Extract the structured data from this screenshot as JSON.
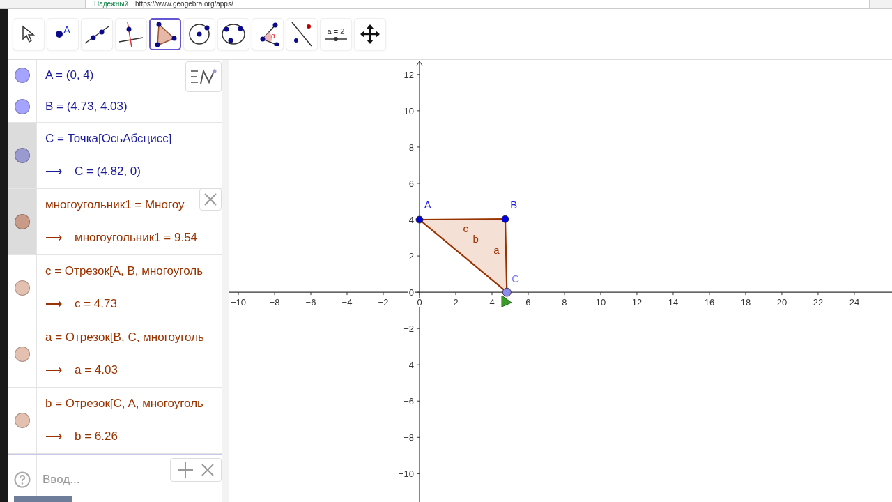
{
  "browser": {
    "security": "Надежный",
    "url": "https://www.geogebra.org/apps/"
  },
  "toolbar": [
    {
      "kind": "move",
      "selected": false
    },
    {
      "kind": "point",
      "label": "A",
      "selected": false
    },
    {
      "kind": "line",
      "selected": false
    },
    {
      "kind": "perpendicular",
      "selected": false
    },
    {
      "kind": "polygon",
      "selected": true
    },
    {
      "kind": "circle",
      "selected": false
    },
    {
      "kind": "conic",
      "selected": false
    },
    {
      "kind": "angle",
      "label": "α",
      "selected": false
    },
    {
      "kind": "reflect",
      "selected": false
    },
    {
      "kind": "slider",
      "label": "a = 2",
      "selected": false
    },
    {
      "kind": "pan",
      "selected": false
    }
  ],
  "algebra": {
    "rows": [
      {
        "kind": "point",
        "color": "#a4a4ff",
        "selected": false,
        "definition": "A = (0, 4)"
      },
      {
        "kind": "point",
        "color": "#a4a4ff",
        "selected": false,
        "definition": "B = (4.73, 4.03)"
      },
      {
        "kind": "point",
        "color": "#9a9ad0",
        "selected": true,
        "definition": "C = Точка[ОсьАбсцисс]",
        "arrow": "⟶",
        "value": "C = (4.82, 0)"
      },
      {
        "kind": "shape",
        "color": "#c99a88",
        "selected": true,
        "definition": "многоугольник1 = Многоу",
        "arrow": "⟶",
        "value": "многоугольник1 = 9.54"
      },
      {
        "kind": "shape",
        "color": "#e4c0b0",
        "selected": false,
        "definition": "c = Отрезок[A, B, многоуголь",
        "arrow": "⟶",
        "value": "c = 4.73"
      },
      {
        "kind": "shape",
        "color": "#e4c0b0",
        "selected": false,
        "definition": "a = Отрезок[B, C, многоуголь",
        "arrow": "⟶",
        "value": "a = 4.03"
      },
      {
        "kind": "shape",
        "color": "#e4c0b0",
        "selected": false,
        "definition": "b = Отрезок[C, A, многоуголь",
        "arrow": "⟶",
        "value": "b = 6.26"
      }
    ],
    "input": {
      "placeholder": "Ввод..."
    }
  },
  "graphics": {
    "chart_data": {
      "type": "area",
      "x": [
        0,
        4.73,
        4.82,
        0
      ],
      "series": [
        {
          "color": "#993300",
          "values": [
            4,
            4.03,
            0,
            4
          ]
        }
      ],
      "xlim": [
        -10.54,
        26.08
      ],
      "ylim": [
        -11.6,
        12.8
      ],
      "xticks": [
        -10,
        -8,
        -6,
        -4,
        -2,
        0,
        2,
        4,
        6,
        8,
        10,
        12,
        14,
        16,
        18,
        20,
        22,
        24
      ],
      "yticks": [
        -10,
        -8,
        -6,
        -4,
        -2,
        0,
        2,
        4,
        6,
        8,
        10,
        12
      ],
      "annotations": [
        "A",
        "B",
        "C",
        "c",
        "b",
        "a"
      ]
    }
  }
}
